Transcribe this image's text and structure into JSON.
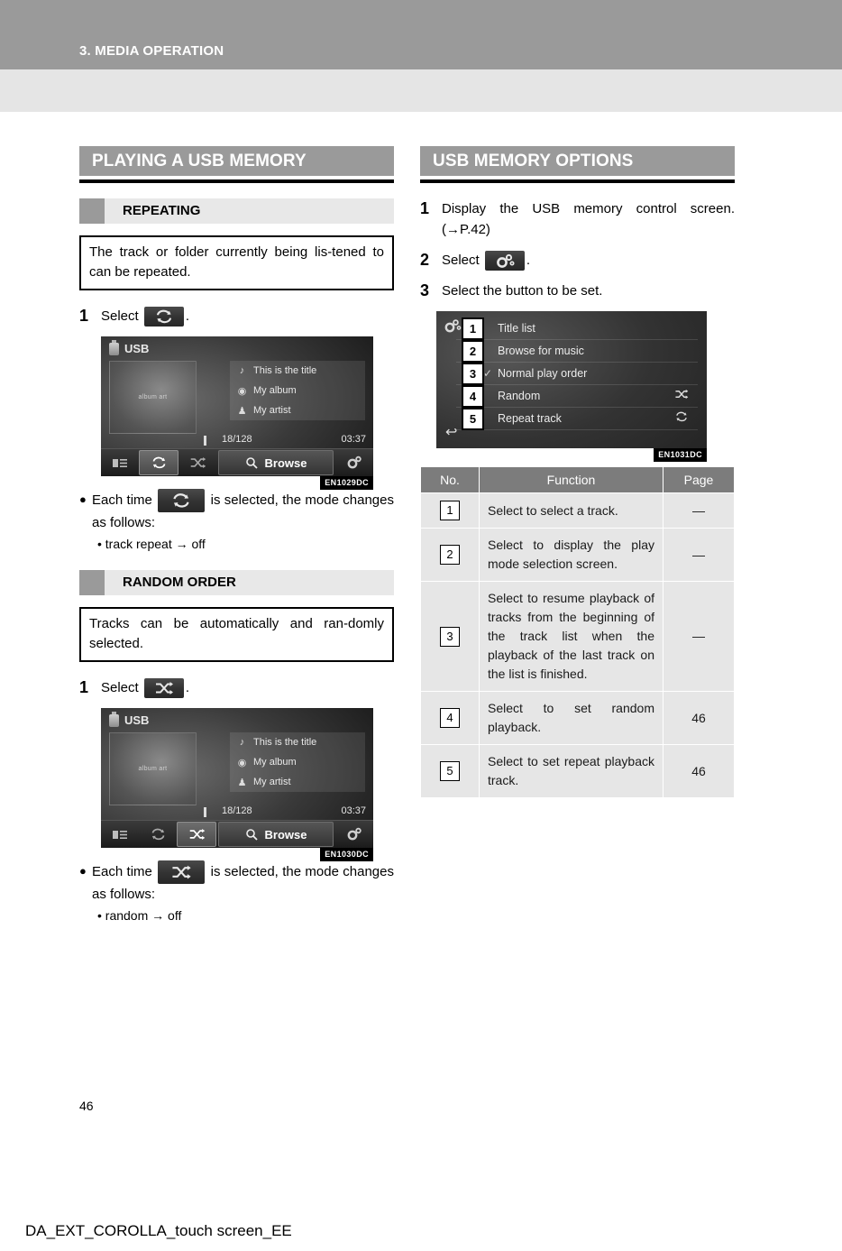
{
  "page": {
    "chapter_title": "3. MEDIA OPERATION",
    "page_number": "46",
    "footer": "DA_EXT_COROLLA_touch screen_EE"
  },
  "left_column": {
    "section_title": "PLAYING A USB MEMORY",
    "subsections": [
      {
        "title": "REPEATING",
        "intro": "The track or folder currently being lis-tened to can be repeated.",
        "step": {
          "number": "1",
          "text_before": "Select",
          "text_after": "."
        },
        "figure": {
          "code": "EN1029DC",
          "source_label": "USB",
          "album_art_label": "album art",
          "track_title": "This is the title",
          "album": "My album",
          "artist": "My artist",
          "track_position": "18/128",
          "track_time": "03:37",
          "browse_label": "Browse",
          "selected_control": "repeat"
        },
        "bullet": {
          "text_before": "Each time",
          "text_after": "is selected, the mode changes as follows:",
          "sub": "• track repeat → off"
        }
      },
      {
        "title": "RANDOM ORDER",
        "intro": "Tracks can be automatically and ran-domly selected.",
        "step": {
          "number": "1",
          "text_before": "Select",
          "text_after": "."
        },
        "figure": {
          "code": "EN1030DC",
          "source_label": "USB",
          "album_art_label": "album art",
          "track_title": "This is the title",
          "album": "My album",
          "artist": "My artist",
          "track_position": "18/128",
          "track_time": "03:37",
          "browse_label": "Browse",
          "selected_control": "random"
        },
        "bullet": {
          "text_before": "Each time",
          "text_after": "is selected, the mode changes as follows:",
          "sub": "• random → off"
        }
      }
    ]
  },
  "right_column": {
    "section_title": "USB MEMORY OPTIONS",
    "steps": [
      {
        "number": "1",
        "text": "Display the USB memory control screen. (→P.42)"
      },
      {
        "number": "2",
        "text_before": "Select",
        "text_after": "."
      },
      {
        "number": "3",
        "text": "Select the button to be set."
      }
    ],
    "figure": {
      "code": "EN1031DC",
      "rows": [
        {
          "callout": "1",
          "label": "Title list",
          "checked": false,
          "right_icon": ""
        },
        {
          "callout": "2",
          "label": "Browse for music",
          "checked": false,
          "right_icon": ""
        },
        {
          "callout": "3",
          "label": "Normal play order",
          "checked": true,
          "right_icon": ""
        },
        {
          "callout": "4",
          "label": "Random",
          "checked": false,
          "right_icon": "shuffle-icon"
        },
        {
          "callout": "5",
          "label": "Repeat track",
          "checked": false,
          "right_icon": "repeat-icon"
        }
      ],
      "back_label": "back-arrow"
    },
    "table": {
      "headers": [
        "No.",
        "Function",
        "Page"
      ],
      "rows": [
        {
          "no": "1",
          "function": "Select to select a track.",
          "page": "—"
        },
        {
          "no": "2",
          "function": "Select to display the play mode selection screen.",
          "page": "—"
        },
        {
          "no": "3",
          "function": "Select to resume playback of tracks from the beginning of the track list when the playback of the last track on the list is finished.",
          "page": "—"
        },
        {
          "no": "4",
          "function": "Select to set random playback.",
          "page": "46"
        },
        {
          "no": "5",
          "function": "Select to set repeat playback track.",
          "page": "46"
        }
      ]
    }
  },
  "colors": {
    "band_gray": "#9a9a9a",
    "sub_band_gray": "#e5e5e5",
    "subsection_gray": "#e8e8e8",
    "table_header_gray": "#7c7c7c",
    "table_cell_gray": "#e6e6e6"
  }
}
